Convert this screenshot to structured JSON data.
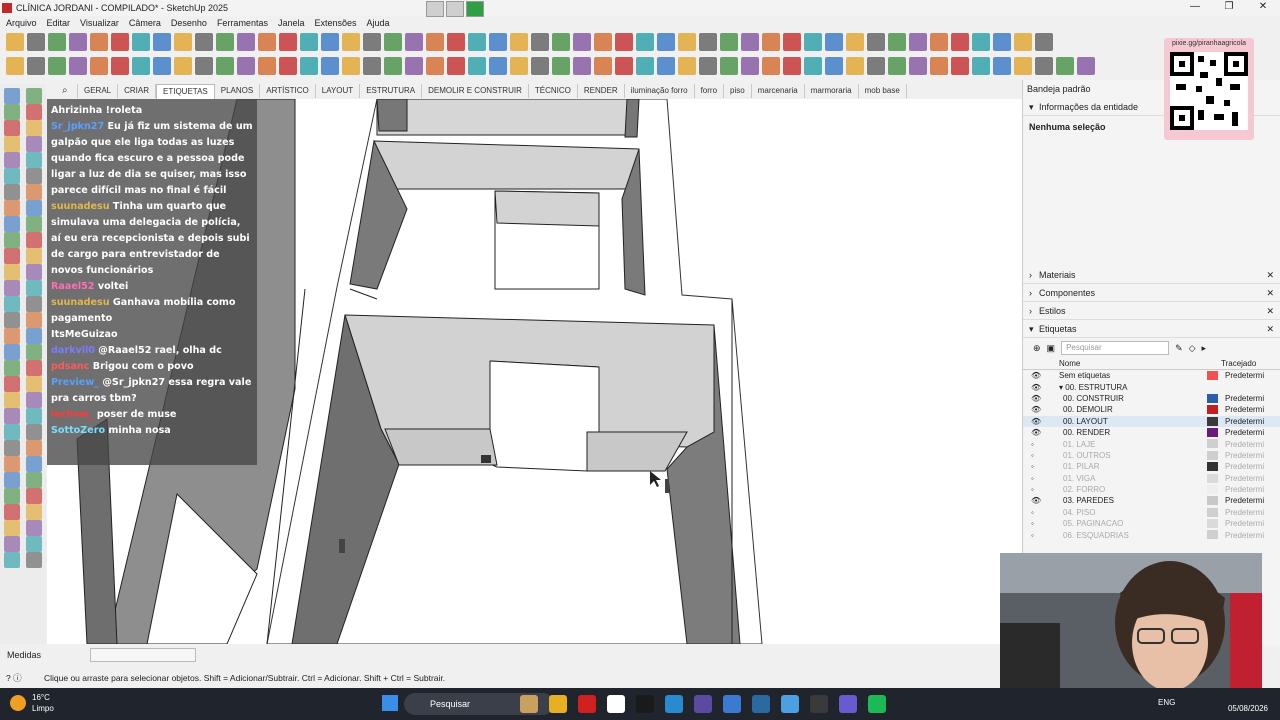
{
  "window": {
    "title": "CLÍNICA JORDANI - COMPILADO* - SketchUp 2025",
    "minimize": "—",
    "maximize": "❐",
    "close": "✕"
  },
  "menu": [
    "Arquivo",
    "Editar",
    "Visualizar",
    "Câmera",
    "Desenho",
    "Ferramentas",
    "Janela",
    "Extensões",
    "Ajuda"
  ],
  "tabs": [
    "GERAL",
    "CRIAR",
    "ETIQUETAS",
    "PLANOS",
    "ARTÍSTICO",
    "LAYOUT",
    "ESTRUTURA",
    "DEMOLIR E CONSTRUIR",
    "TÉCNICO",
    "RENDER",
    "iluminação forro",
    "forro",
    "piso",
    "marcenaria",
    "marmoraria",
    "mob base"
  ],
  "active_tab": "ETIQUETAS",
  "chat": [
    {
      "user": "Ahrizinha",
      "user_color": "#ffffff",
      "text": "!roleta"
    },
    {
      "user": "Sr_jpkn27",
      "user_color": "#5aa0ff",
      "text": "Eu já fiz um sistema de um galpão que ele liga todas as luzes quando fica escuro e a pessoa pode ligar a luz de dia se quiser, mas isso parece difícil mas no final é fácil"
    },
    {
      "user": "suunadesu",
      "user_color": "#e0b84a",
      "text": "Tinha um quarto que simulava uma delegacia de polícia, aí eu era recepcionista e depois subi de cargo para entrevistador de novos funcionários"
    },
    {
      "user": "Raael52",
      "user_color": "#ff6fb5",
      "text": "voltei"
    },
    {
      "user": "suunadesu",
      "user_color": "#e0b84a",
      "text": "Ganhava mobília como pagamento"
    },
    {
      "user": "ItsMeGuizao",
      "user_color": "#ffffff",
      "text": ""
    },
    {
      "user": "darkvil0",
      "user_color": "#7a7cff",
      "text": "@Raael52 rael, olha dc"
    },
    {
      "user": "pdsanc",
      "user_color": "#ff5a5a",
      "text": "Brigou com o povo"
    },
    {
      "user": "Preview_",
      "user_color": "#5aa0ff",
      "text": "@Sr_jpkn27 essa regra vale pra carros tbm?"
    },
    {
      "user": "lechow_",
      "user_color": "#ff3a3a",
      "text": "poser de muse"
    },
    {
      "user": "SottoZero",
      "user_color": "#7adfff",
      "text": "minha nosa"
    }
  ],
  "tray": {
    "title": "Bandeja padrão",
    "entity_info": "Informações da entidade",
    "no_selection": "Nenhuma seleção",
    "materials": "Materiais",
    "components": "Componentes",
    "styles": "Estilos",
    "tags": "Etiquetas",
    "search_placeholder": "Pesquisar",
    "col_name": "Nome",
    "col_trace": "Tracejado",
    "tag_rows": [
      {
        "name": "Sem etiquetas",
        "color": "#f05050",
        "trace": "Predetermi",
        "visible": true,
        "indent": 0
      },
      {
        "name": "▾ 00. ESTRUTURA",
        "color": "",
        "trace": "",
        "visible": true,
        "indent": 0
      },
      {
        "name": "00. CONSTRUIR",
        "color": "#2d5fa8",
        "trace": "Predetermi",
        "visible": true,
        "indent": 1
      },
      {
        "name": "00. DEMOLIR",
        "color": "#c02020",
        "trace": "Predetermi",
        "visible": true,
        "indent": 1
      },
      {
        "name": "00. LAYOUT",
        "color": "#3a3a3a",
        "trace": "Predetermi",
        "visible": true,
        "indent": 1,
        "selected": true
      },
      {
        "name": "00. RENDER",
        "color": "#6a1a7a",
        "trace": "Predetermi",
        "visible": true,
        "indent": 1
      },
      {
        "name": "01. LAJE",
        "color": "#cfcfcf",
        "trace": "Predetermi",
        "visible": false,
        "indent": 1
      },
      {
        "name": "01. OUTROS",
        "color": "#cfcfcf",
        "trace": "Predetermi",
        "visible": false,
        "indent": 1
      },
      {
        "name": "01. PILAR",
        "color": "#333333",
        "trace": "Predetermi",
        "visible": false,
        "indent": 1
      },
      {
        "name": "01. VIGA",
        "color": "#dadada",
        "trace": "Predetermi",
        "visible": false,
        "indent": 1
      },
      {
        "name": "02. FORRO",
        "color": "#eeeeee",
        "trace": "Predetermi",
        "visible": false,
        "indent": 1
      },
      {
        "name": "03. PAREDES",
        "color": "#c8c8c8",
        "trace": "Predetermi",
        "visible": true,
        "indent": 1
      },
      {
        "name": "04. PISO",
        "color": "#cfcfcf",
        "trace": "Predetermi",
        "visible": false,
        "indent": 1
      },
      {
        "name": "05. PAGINACAO",
        "color": "#dadada",
        "trace": "Predetermi",
        "visible": false,
        "indent": 1
      },
      {
        "name": "06. ESQUADRIAS",
        "color": "#cfcfcf",
        "trace": "Predetermi",
        "visible": false,
        "indent": 1
      }
    ]
  },
  "qr": {
    "label": "pixie.gg/piranhaagricola"
  },
  "measures": {
    "label": "Medidas",
    "value": ""
  },
  "status": {
    "hint": "Clique ou arraste para selecionar objetos. Shift = Adicionar/Subtrair. Ctrl = Adicionar. Shift + Ctrl = Subtrair."
  },
  "taskbar": {
    "temperature": "16°C",
    "weather": "Limpo",
    "search": "Pesquisar",
    "language": "ENG",
    "date": "05/08/2026"
  }
}
